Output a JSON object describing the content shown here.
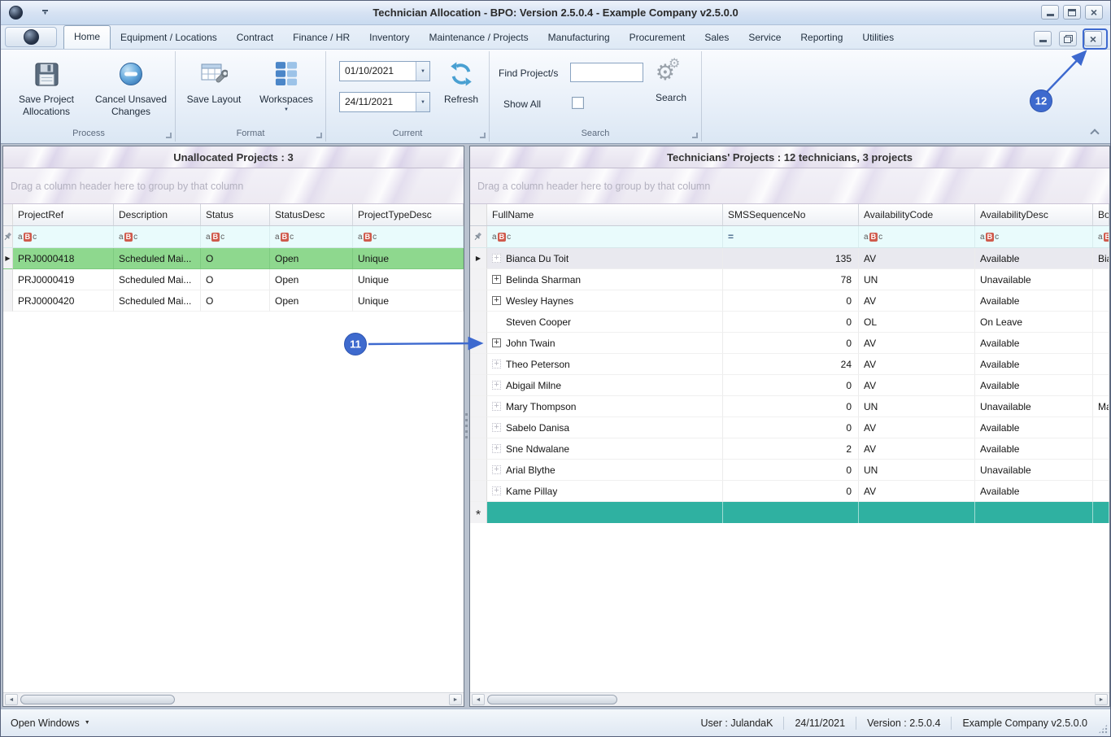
{
  "titlebar": {
    "title": "Technician Allocation - BPO: Version 2.5.0.4 - Example Company v2.5.0.0"
  },
  "ribbon": {
    "tabs": [
      "Home",
      "Equipment / Locations",
      "Contract",
      "Finance / HR",
      "Inventory",
      "Maintenance / Projects",
      "Manufacturing",
      "Procurement",
      "Sales",
      "Service",
      "Reporting",
      "Utilities"
    ],
    "active_tab": "Home",
    "groups": {
      "process": {
        "label": "Process",
        "save_allocations": "Save Project Allocations",
        "cancel_changes": "Cancel Unsaved Changes"
      },
      "format": {
        "label": "Format",
        "save_layout": "Save Layout",
        "workspaces": "Workspaces"
      },
      "current": {
        "label": "Current",
        "date_from": "01/10/2021",
        "date_to": "24/11/2021",
        "refresh": "Refresh"
      },
      "search": {
        "label": "Search",
        "find_label": "Find Project/s",
        "find_value": "",
        "show_all_label": "Show All",
        "show_all_checked": false,
        "search_button": "Search"
      }
    }
  },
  "left_grid": {
    "title": "Unallocated Projects : 3",
    "group_hint": "Drag a column header here to group by that column",
    "columns": [
      {
        "label": "ProjectRef",
        "filter": "text"
      },
      {
        "label": "Description",
        "filter": "text"
      },
      {
        "label": "Status",
        "filter": "text"
      },
      {
        "label": "StatusDesc",
        "filter": "text"
      },
      {
        "label": "ProjectTypeDesc",
        "filter": "text"
      }
    ],
    "rows": [
      {
        "cells": [
          "PRJ0000418",
          "Scheduled Mai...",
          "O",
          "Open",
          "Unique"
        ],
        "selected": true
      },
      {
        "cells": [
          "PRJ0000419",
          "Scheduled Mai...",
          "O",
          "Open",
          "Unique"
        ],
        "selected": false
      },
      {
        "cells": [
          "PRJ0000420",
          "Scheduled Mai...",
          "O",
          "Open",
          "Unique"
        ],
        "selected": false
      }
    ]
  },
  "right_grid": {
    "title": "Technicians' Projects : 12 technicians, 3 projects",
    "group_hint": "Drag a column header here to group by that column",
    "columns": [
      {
        "label": "FullName",
        "filter": "text"
      },
      {
        "label": "SMSSequenceNo",
        "filter": "numeric"
      },
      {
        "label": "AvailabilityCode",
        "filter": "text"
      },
      {
        "label": "AvailabilityDesc",
        "filter": "text"
      },
      {
        "label": "Boo",
        "filter": "text"
      }
    ],
    "rows": [
      {
        "name": "Bianca Du Toit",
        "sms": "135",
        "code": "AV",
        "desc": "Available",
        "more": "Bia",
        "expand": "faint",
        "selected": true
      },
      {
        "name": "Belinda Sharman",
        "sms": "78",
        "code": "UN",
        "desc": "Unavailable",
        "more": "",
        "expand": "solid",
        "selected": false
      },
      {
        "name": "Wesley Haynes",
        "sms": "0",
        "code": "AV",
        "desc": "Available",
        "more": "",
        "expand": "solid",
        "selected": false
      },
      {
        "name": "Steven Cooper",
        "sms": "0",
        "code": "OL",
        "desc": "On Leave",
        "more": "",
        "expand": "none",
        "selected": false
      },
      {
        "name": "John Twain",
        "sms": "0",
        "code": "AV",
        "desc": "Available",
        "more": "",
        "expand": "solid",
        "selected": false
      },
      {
        "name": "Theo Peterson",
        "sms": "24",
        "code": "AV",
        "desc": "Available",
        "more": "",
        "expand": "faint",
        "selected": false
      },
      {
        "name": "Abigail Milne",
        "sms": "0",
        "code": "AV",
        "desc": "Available",
        "more": "",
        "expand": "faint",
        "selected": false
      },
      {
        "name": "Mary Thompson",
        "sms": "0",
        "code": "UN",
        "desc": "Unavailable",
        "more": "Ma",
        "expand": "faint",
        "selected": false
      },
      {
        "name": "Sabelo Danisa",
        "sms": "0",
        "code": "AV",
        "desc": "Available",
        "more": "",
        "expand": "faint",
        "selected": false
      },
      {
        "name": "Sne Ndwalane",
        "sms": "2",
        "code": "AV",
        "desc": "Available",
        "more": "",
        "expand": "faint",
        "selected": false
      },
      {
        "name": "Arial Blythe",
        "sms": "0",
        "code": "UN",
        "desc": "Unavailable",
        "more": "",
        "expand": "faint",
        "selected": false
      },
      {
        "name": "Kame Pillay",
        "sms": "0",
        "code": "AV",
        "desc": "Available",
        "more": "",
        "expand": "faint",
        "selected": false
      }
    ],
    "new_row_color": "#2fb1a1"
  },
  "statusbar": {
    "open_windows": "Open Windows",
    "right_items": [
      "User : JulandaK",
      "24/11/2021",
      "Version : 2.5.0.4",
      "Example Company v2.5.0.0"
    ]
  },
  "annotations": {
    "step_11": "11",
    "step_12": "12",
    "accent": "#3d69cf"
  },
  "colors": {
    "selected_row_green": "#8ed88e",
    "new_row_teal": "#2fb1a1",
    "filter_row_cyan": "#e9fbfc"
  },
  "icons": {
    "dropdown": "▼",
    "row_indicator": "▶",
    "new_row": "*",
    "expand": "+",
    "filter_a": "a",
    "filter_b": "B",
    "filter_c": "c",
    "filter_eq": "=",
    "scroll_left": "◄",
    "scroll_right": "►",
    "close": "×",
    "gear": "⚙"
  }
}
